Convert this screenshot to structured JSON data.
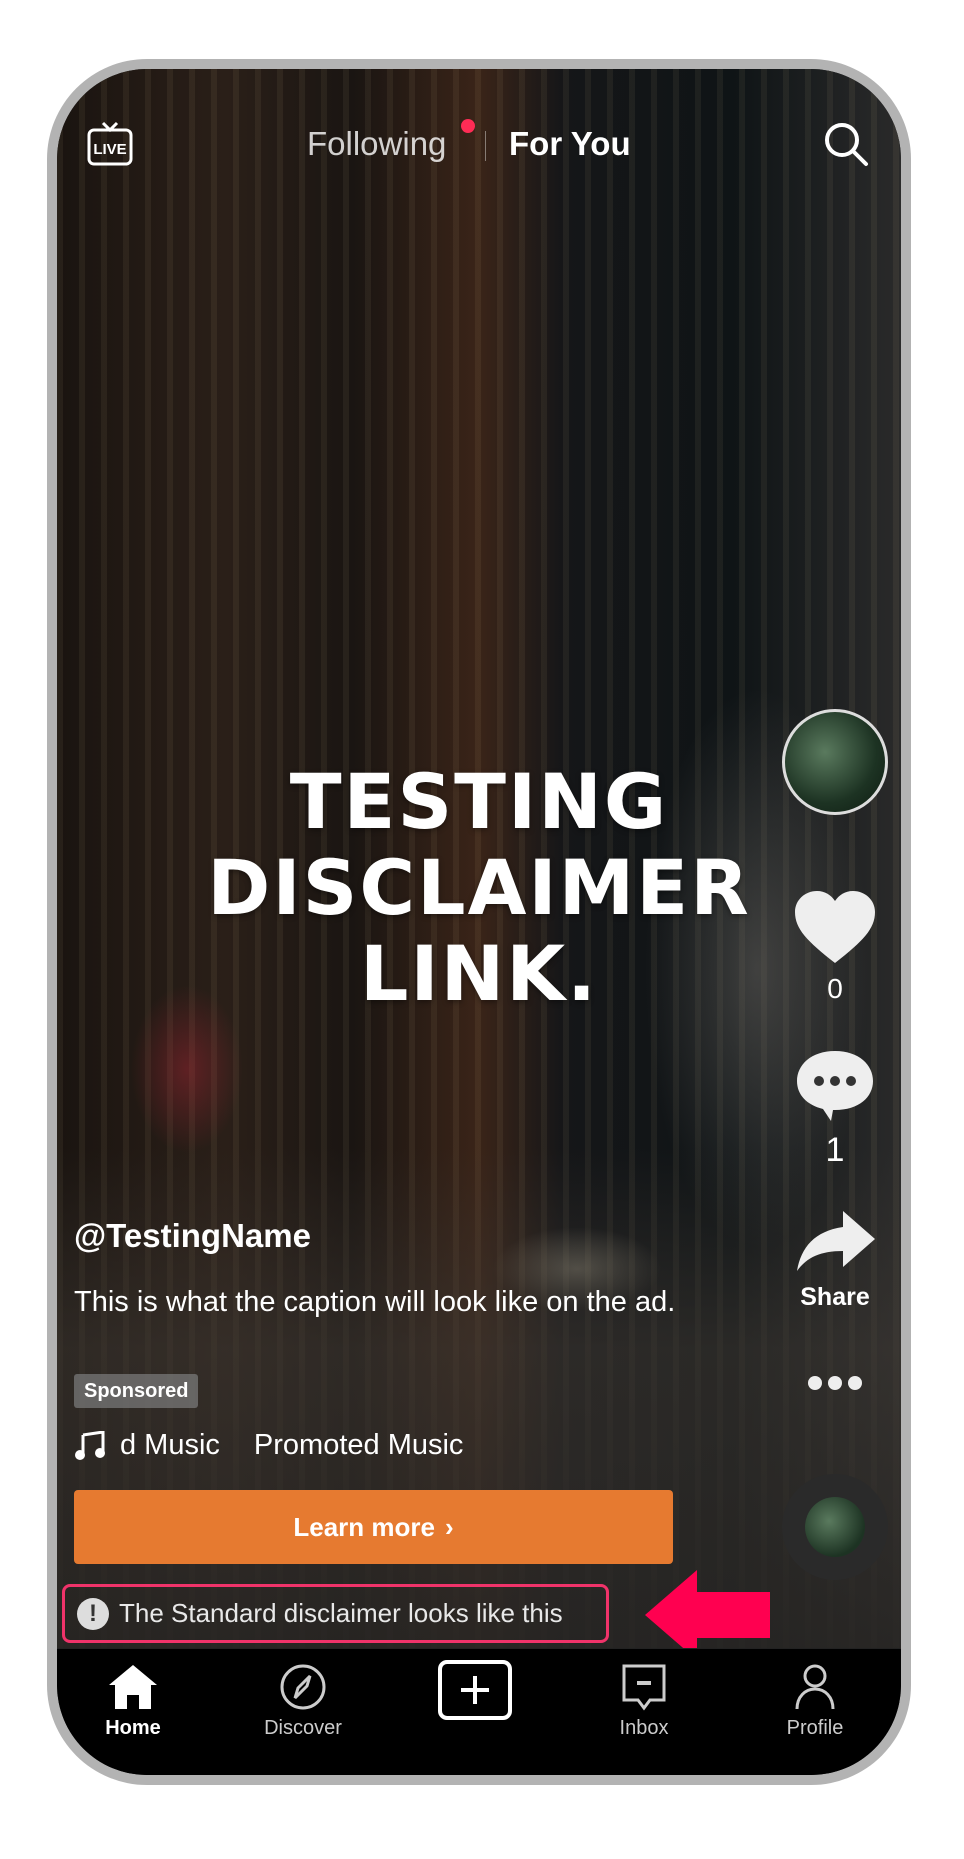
{
  "header": {
    "live_label": "LIVE",
    "tabs": [
      {
        "label": "Following",
        "notification_dot": true
      },
      {
        "label": "For You",
        "active": true
      }
    ]
  },
  "video": {
    "overlay_text": [
      "TESTING",
      "DISCLAIMER",
      "LINK."
    ]
  },
  "rail": {
    "likes": "0",
    "comments": "1",
    "share_label": "Share"
  },
  "post": {
    "username": "@TestingName",
    "caption": "This is what the caption will look like on the ad.",
    "sponsored_label": "Sponsored",
    "music": [
      "d Music",
      "Promoted Music"
    ],
    "cta_label": "Learn more"
  },
  "disclaimer": {
    "text": "The Standard disclaimer looks like this",
    "highlight_color": "#f0336a",
    "arrow_color": "#ff0050"
  },
  "nav": {
    "items": [
      {
        "label": "Home",
        "icon": "home-icon",
        "active": true
      },
      {
        "label": "Discover",
        "icon": "compass-icon"
      },
      {
        "label": "",
        "icon": "plus-icon"
      },
      {
        "label": "Inbox",
        "icon": "inbox-icon"
      },
      {
        "label": "Profile",
        "icon": "profile-icon"
      }
    ]
  },
  "colors": {
    "cta": "#e67a30",
    "notification": "#fe2c55"
  }
}
